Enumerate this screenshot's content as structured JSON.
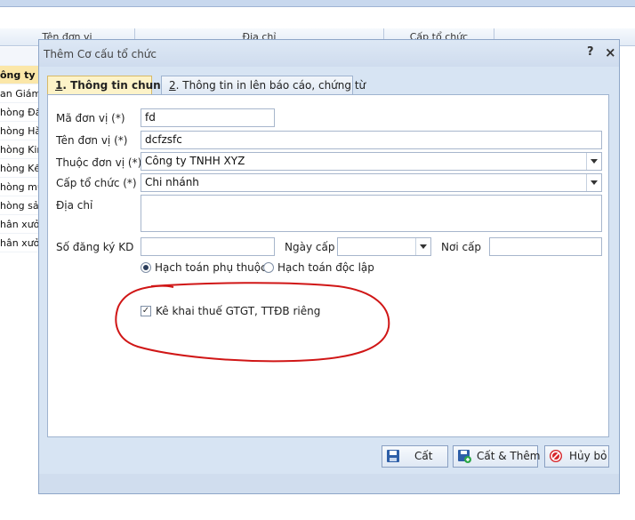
{
  "background": {
    "columns": [
      "Tên đơn vị",
      "Địa chỉ",
      "Cấp tổ chức"
    ],
    "rows": [
      "ông ty T",
      "an Giám",
      "hòng Đầu",
      "hòng Hàn",
      "hòng Kinh",
      "hòng Kế t",
      "hòng mua",
      "hòng sản",
      "hân xưởn",
      "hân xưởn"
    ]
  },
  "dialog": {
    "title": "Thêm Cơ cấu tổ chức",
    "help_label": "?",
    "close_label": "×",
    "tabs": [
      {
        "key": "1",
        "label": ". Thông tin chung"
      },
      {
        "key": "2",
        "label": ". Thông tin in lên báo cáo, chứng từ"
      }
    ],
    "form": {
      "ma_don_vi": {
        "label": "Mã đơn vị (*)",
        "value": "fd"
      },
      "ten_don_vi": {
        "label": "Tên đơn vị (*)",
        "value": "dcfzsfc"
      },
      "thuoc_don_vi": {
        "label": "Thuộc đơn vị (*)",
        "value": "Công ty TNHH XYZ"
      },
      "cap_to_chuc": {
        "label": "Cấp tổ chức (*)",
        "value": "Chi nhánh"
      },
      "dia_chi": {
        "label": "Địa chỉ",
        "value": ""
      },
      "so_dang_ky": {
        "label": "Số đăng ký KD",
        "value": ""
      },
      "ngay_cap": {
        "label": "Ngày cấp",
        "value": ""
      },
      "noi_cap": {
        "label": "Nơi cấp",
        "value": ""
      },
      "radio_phu_thuoc": "Hạch toán phụ thuộc",
      "radio_doc_lap": "Hạch toán độc lập",
      "check_ke_khai": "Kê khai thuế GTGT, TTĐB riêng",
      "check_mark": "✓"
    },
    "buttons": {
      "save": "Cất",
      "save_add": "Cất & Thêm",
      "cancel": "Hủy bỏ"
    }
  },
  "colors": {
    "annotation_red": "#d01616",
    "active_tab": "#fdf3c8",
    "dialog_bg": "#d7e4f3"
  }
}
